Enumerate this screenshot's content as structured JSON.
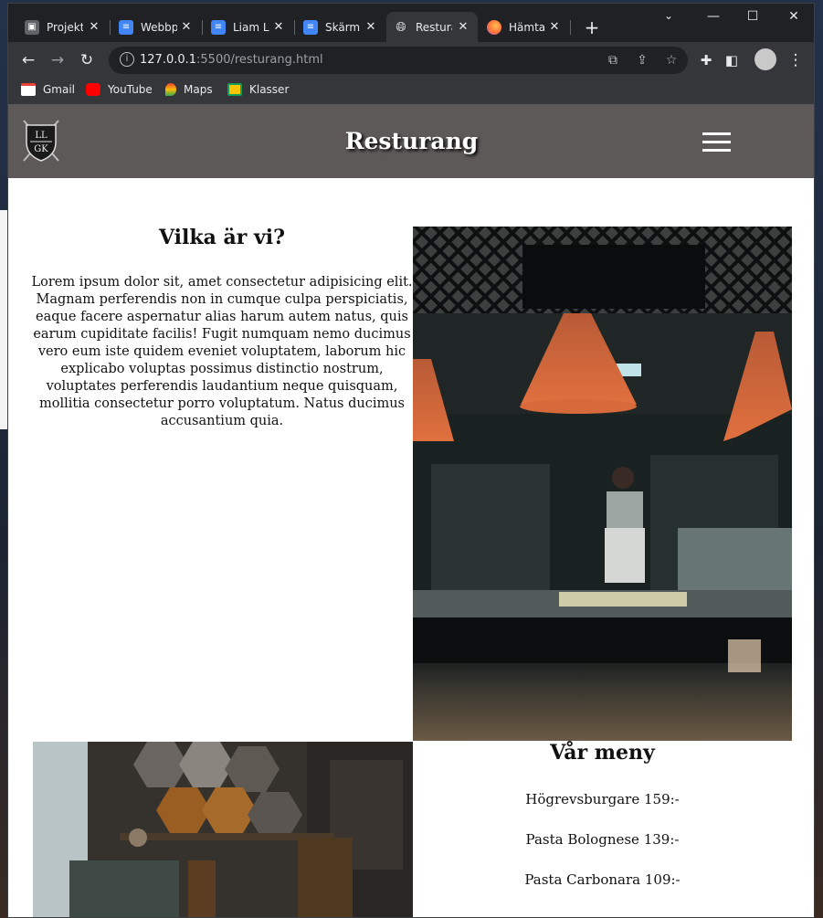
{
  "browser": {
    "tabs": [
      {
        "label": "Projekt",
        "favicon": "classroom-icon",
        "color": "#5f6368"
      },
      {
        "label": "Webbp",
        "favicon": "docs-icon",
        "color": "#4285f4"
      },
      {
        "label": "Liam L",
        "favicon": "docs-icon",
        "color": "#4285f4"
      },
      {
        "label": "Skärm",
        "favicon": "docs-icon",
        "color": "#4285f4"
      },
      {
        "label": "Restura",
        "favicon": "globe-icon",
        "color": "#e8eaed"
      },
      {
        "label": "Hämta",
        "favicon": "firefox-icon",
        "color": "#ff7139"
      }
    ],
    "url_host": "127.0.0.1",
    "url_rest": ":5500/resturang.html",
    "bookmarks": [
      "Gmail",
      "YouTube",
      "Maps",
      "Klasser"
    ]
  },
  "site": {
    "logo_top": "LL",
    "logo_bottom": "GK",
    "title": "Resturang",
    "about_heading": "Vilka är vi?",
    "about_text": "Lorem ipsum dolor sit, amet consectetur adipisicing elit. Magnam perferendis non in cumque culpa perspiciatis, eaque facere aspernatur alias harum autem natus, quis earum cupiditate facilis! Fugit numquam nemo ducimus vero eum iste quidem eveniet voluptatem, laborum hic explicabo voluptas possimus distinctio nostrum, voluptates perferendis laudantium neque quisquam, mollitia consectetur porro voluptatum. Natus ducimus accusantium quia.",
    "menu_heading": "Vår meny",
    "menu_items": [
      "Högrevsburgare 159:-",
      "Pasta Bolognese 139:-",
      "Pasta Carbonara 109:-"
    ]
  },
  "colors": {
    "header_bg": "#5e5959",
    "chrome_dark": "#202124",
    "chrome_toolbar": "#35363a"
  }
}
